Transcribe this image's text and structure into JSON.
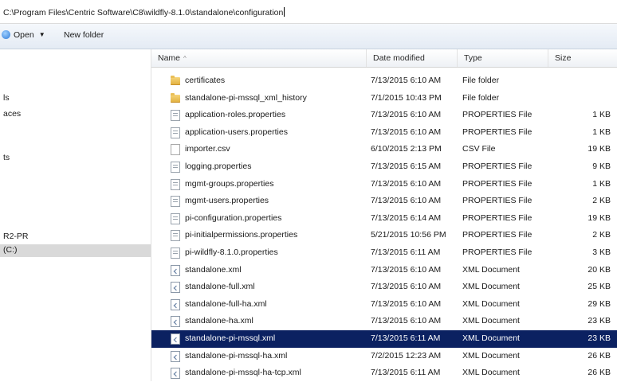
{
  "address_bar": {
    "path": "C:\\Program Files\\Centric Software\\C8\\wildfly-8.1.0\\standalone\\configuration"
  },
  "toolbar": {
    "open_label": "Open",
    "new_folder_label": "New folder"
  },
  "nav": {
    "items": [
      {
        "label": "ls",
        "selected": false
      },
      {
        "label": "aces",
        "selected": false
      },
      {
        "label": "ts",
        "selected": false
      },
      {
        "label": "R2-PR",
        "selected": false
      },
      {
        "label": "(C:)",
        "selected": true
      }
    ]
  },
  "columns": {
    "name": "Name",
    "date": "Date modified",
    "type": "Type",
    "size": "Size"
  },
  "files": [
    {
      "icon": "folder-icon",
      "name": "certificates",
      "date": "7/13/2015 6:10 AM",
      "type": "File folder",
      "size": ""
    },
    {
      "icon": "folder-icon",
      "name": "standalone-pi-mssql_xml_history",
      "date": "7/1/2015 10:43 PM",
      "type": "File folder",
      "size": ""
    },
    {
      "icon": "properties-file-icon",
      "name": "application-roles.properties",
      "date": "7/13/2015 6:10 AM",
      "type": "PROPERTIES File",
      "size": "1 KB"
    },
    {
      "icon": "properties-file-icon",
      "name": "application-users.properties",
      "date": "7/13/2015 6:10 AM",
      "type": "PROPERTIES File",
      "size": "1 KB"
    },
    {
      "icon": "blank-file-icon",
      "name": "importer.csv",
      "date": "6/10/2015 2:13 PM",
      "type": "CSV File",
      "size": "19 KB"
    },
    {
      "icon": "properties-file-icon",
      "name": "logging.properties",
      "date": "7/13/2015 6:15 AM",
      "type": "PROPERTIES File",
      "size": "9 KB"
    },
    {
      "icon": "properties-file-icon",
      "name": "mgmt-groups.properties",
      "date": "7/13/2015 6:10 AM",
      "type": "PROPERTIES File",
      "size": "1 KB"
    },
    {
      "icon": "properties-file-icon",
      "name": "mgmt-users.properties",
      "date": "7/13/2015 6:10 AM",
      "type": "PROPERTIES File",
      "size": "2 KB"
    },
    {
      "icon": "properties-file-icon",
      "name": "pi-configuration.properties",
      "date": "7/13/2015 6:14 AM",
      "type": "PROPERTIES File",
      "size": "19 KB"
    },
    {
      "icon": "properties-file-icon",
      "name": "pi-initialpermissions.properties",
      "date": "5/21/2015 10:56 PM",
      "type": "PROPERTIES File",
      "size": "2 KB"
    },
    {
      "icon": "properties-file-icon",
      "name": "pi-wildfly-8.1.0.properties",
      "date": "7/13/2015 6:11 AM",
      "type": "PROPERTIES File",
      "size": "3 KB"
    },
    {
      "icon": "xml-file-icon",
      "name": "standalone.xml",
      "date": "7/13/2015 6:10 AM",
      "type": "XML Document",
      "size": "20 KB"
    },
    {
      "icon": "xml-file-icon",
      "name": "standalone-full.xml",
      "date": "7/13/2015 6:10 AM",
      "type": "XML Document",
      "size": "25 KB"
    },
    {
      "icon": "xml-file-icon",
      "name": "standalone-full-ha.xml",
      "date": "7/13/2015 6:10 AM",
      "type": "XML Document",
      "size": "29 KB"
    },
    {
      "icon": "xml-file-icon",
      "name": "standalone-ha.xml",
      "date": "7/13/2015 6:10 AM",
      "type": "XML Document",
      "size": "23 KB"
    },
    {
      "icon": "xml-file-icon",
      "name": "standalone-pi-mssql.xml",
      "date": "7/13/2015 6:11 AM",
      "type": "XML Document",
      "size": "23 KB",
      "selected": true
    },
    {
      "icon": "xml-file-icon",
      "name": "standalone-pi-mssql-ha.xml",
      "date": "7/2/2015 12:23 AM",
      "type": "XML Document",
      "size": "26 KB"
    },
    {
      "icon": "xml-file-icon",
      "name": "standalone-pi-mssql-ha-tcp.xml",
      "date": "7/13/2015 6:11 AM",
      "type": "XML Document",
      "size": "26 KB"
    }
  ],
  "colors": {
    "selection": "#0b2161",
    "nav_selection": "#d9d9d9",
    "toolbar": "#e4ebf4"
  }
}
